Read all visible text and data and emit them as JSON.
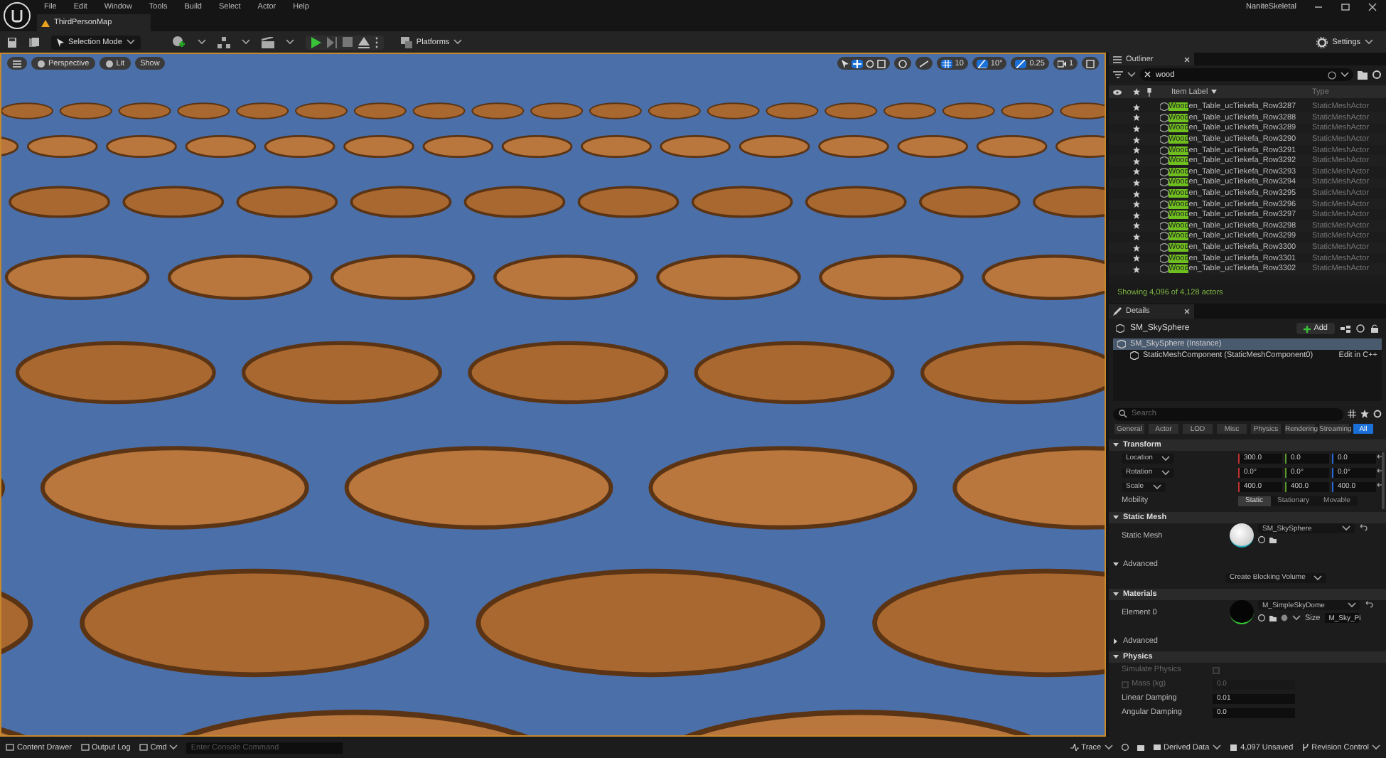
{
  "menu": {
    "items": [
      "File",
      "Edit",
      "Window",
      "Tools",
      "Build",
      "Select",
      "Actor",
      "Help"
    ],
    "project": "NaniteSkeletal"
  },
  "document_tab": {
    "label": "ThirdPersonMap"
  },
  "toolbar": {
    "mode": "Selection Mode",
    "platforms": "Platforms",
    "settings": "Settings"
  },
  "viewport": {
    "buttons": [
      "Perspective",
      "Lit",
      "Show"
    ],
    "grid_snap": "10",
    "rotation_snap": "10°",
    "scale_snap": "0.25",
    "camera_speed": "1"
  },
  "outliner": {
    "title": "Outliner",
    "search": "wood",
    "columns": [
      "Item Label",
      "Type"
    ],
    "rows": [
      {
        "match": "Wood",
        "rest": "en_Table_ucTiekefa_Row3287",
        "type": "StaticMeshActor"
      },
      {
        "match": "Wood",
        "rest": "en_Table_ucTiekefa_Row3288",
        "type": "StaticMeshActor"
      },
      {
        "match": "Wood",
        "rest": "en_Table_ucTiekefa_Row3289",
        "type": "StaticMeshActor"
      },
      {
        "match": "Wood",
        "rest": "en_Table_ucTiekefa_Row3290",
        "type": "StaticMeshActor"
      },
      {
        "match": "Wood",
        "rest": "en_Table_ucTiekefa_Row3291",
        "type": "StaticMeshActor"
      },
      {
        "match": "Wood",
        "rest": "en_Table_ucTiekefa_Row3292",
        "type": "StaticMeshActor"
      },
      {
        "match": "Wood",
        "rest": "en_Table_ucTiekefa_Row3293",
        "type": "StaticMeshActor"
      },
      {
        "match": "Wood",
        "rest": "en_Table_ucTiekefa_Row3294",
        "type": "StaticMeshActor"
      },
      {
        "match": "Wood",
        "rest": "en_Table_ucTiekefa_Row3295",
        "type": "StaticMeshActor"
      },
      {
        "match": "Wood",
        "rest": "en_Table_ucTiekefa_Row3296",
        "type": "StaticMeshActor"
      },
      {
        "match": "Wood",
        "rest": "en_Table_ucTiekefa_Row3297",
        "type": "StaticMeshActor"
      },
      {
        "match": "Wood",
        "rest": "en_Table_ucTiekefa_Row3298",
        "type": "StaticMeshActor"
      },
      {
        "match": "Wood",
        "rest": "en_Table_ucTiekefa_Row3299",
        "type": "StaticMeshActor"
      },
      {
        "match": "Wood",
        "rest": "en_Table_ucTiekefa_Row3300",
        "type": "StaticMeshActor"
      },
      {
        "match": "Wood",
        "rest": "en_Table_ucTiekefa_Row3301",
        "type": "StaticMeshActor"
      },
      {
        "match": "Wood",
        "rest": "en_Table_ucTiekefa_Row3302",
        "type": "StaticMeshActor"
      }
    ],
    "footer": "Showing 4,096 of 4,128 actors"
  },
  "details": {
    "title": "Details",
    "actor": "SM_SkySphere",
    "add": "Add",
    "tree": [
      {
        "label": "SM_SkySphere (Instance)",
        "selected": true
      },
      {
        "label": "StaticMeshComponent (StaticMeshComponent0)",
        "selected": false
      }
    ],
    "edit_code": "Edit in C++",
    "search_placeholder": "Search",
    "filters": [
      {
        "label": "General",
        "selected": false
      },
      {
        "label": "Actor",
        "selected": false
      },
      {
        "label": "LOD",
        "selected": false
      },
      {
        "label": "Misc",
        "selected": false
      },
      {
        "label": "Physics",
        "selected": false
      },
      {
        "label": "Rendering",
        "selected": false
      },
      {
        "label": "Streaming",
        "selected": false
      },
      {
        "label": "All",
        "selected": true
      }
    ],
    "transform": {
      "title": "Transform",
      "expanded": true,
      "rows": [
        {
          "label": "Location",
          "values": [
            "300.0",
            "0.0",
            "0.0"
          ]
        },
        {
          "label": "Rotation",
          "values": [
            "0.0°",
            "0.0°",
            "0.0°"
          ]
        },
        {
          "label": "Scale",
          "values": [
            "400.0",
            "400.0",
            "400.0"
          ]
        }
      ],
      "mobility": {
        "label": "Mobility",
        "options": [
          {
            "label": "Static",
            "selected": true
          },
          {
            "label": "Stationary",
            "selected": false
          },
          {
            "label": "Movable",
            "selected": false
          }
        ]
      }
    },
    "static_mesh": {
      "title": "Static Mesh",
      "expanded": true,
      "label": "Static Mesh",
      "asset": "SM_SkySphere"
    },
    "advanced": {
      "title": "Advanced",
      "expanded": true,
      "button": "Create Blocking Volume"
    },
    "materials": {
      "title": "Materials",
      "expanded": true,
      "label": "Element 0",
      "asset": "M_SimpleSkyDome",
      "size_label": "Size",
      "size_value": "M_Sky_Pi"
    },
    "advanced_2": {
      "title": "Advanced",
      "expanded": false
    },
    "physics": {
      "title": "Physics",
      "expanded": true,
      "rows": [
        {
          "kind": "checkbox",
          "label": "Simulate Physics",
          "checked": false,
          "disabled": true
        },
        {
          "kind": "checkvalue",
          "label": "Mass (kg)",
          "checked": false,
          "disabled": true,
          "value": "0.0"
        },
        {
          "kind": "value",
          "label": "Linear Damping",
          "value": "0.01",
          "disabled": false
        },
        {
          "kind": "value",
          "label": "Angular Damping",
          "value": "0.0",
          "disabled": false
        }
      ]
    }
  },
  "status_bar": {
    "content_drawer": "Content Drawer",
    "output_log": "Output Log",
    "cmd": "Cmd",
    "console_placeholder": "Enter Console Command",
    "trace": "Trace",
    "derived_data": "Derived Data",
    "unsaved": "4,097 Unsaved",
    "revision_control": "Revision Control"
  }
}
